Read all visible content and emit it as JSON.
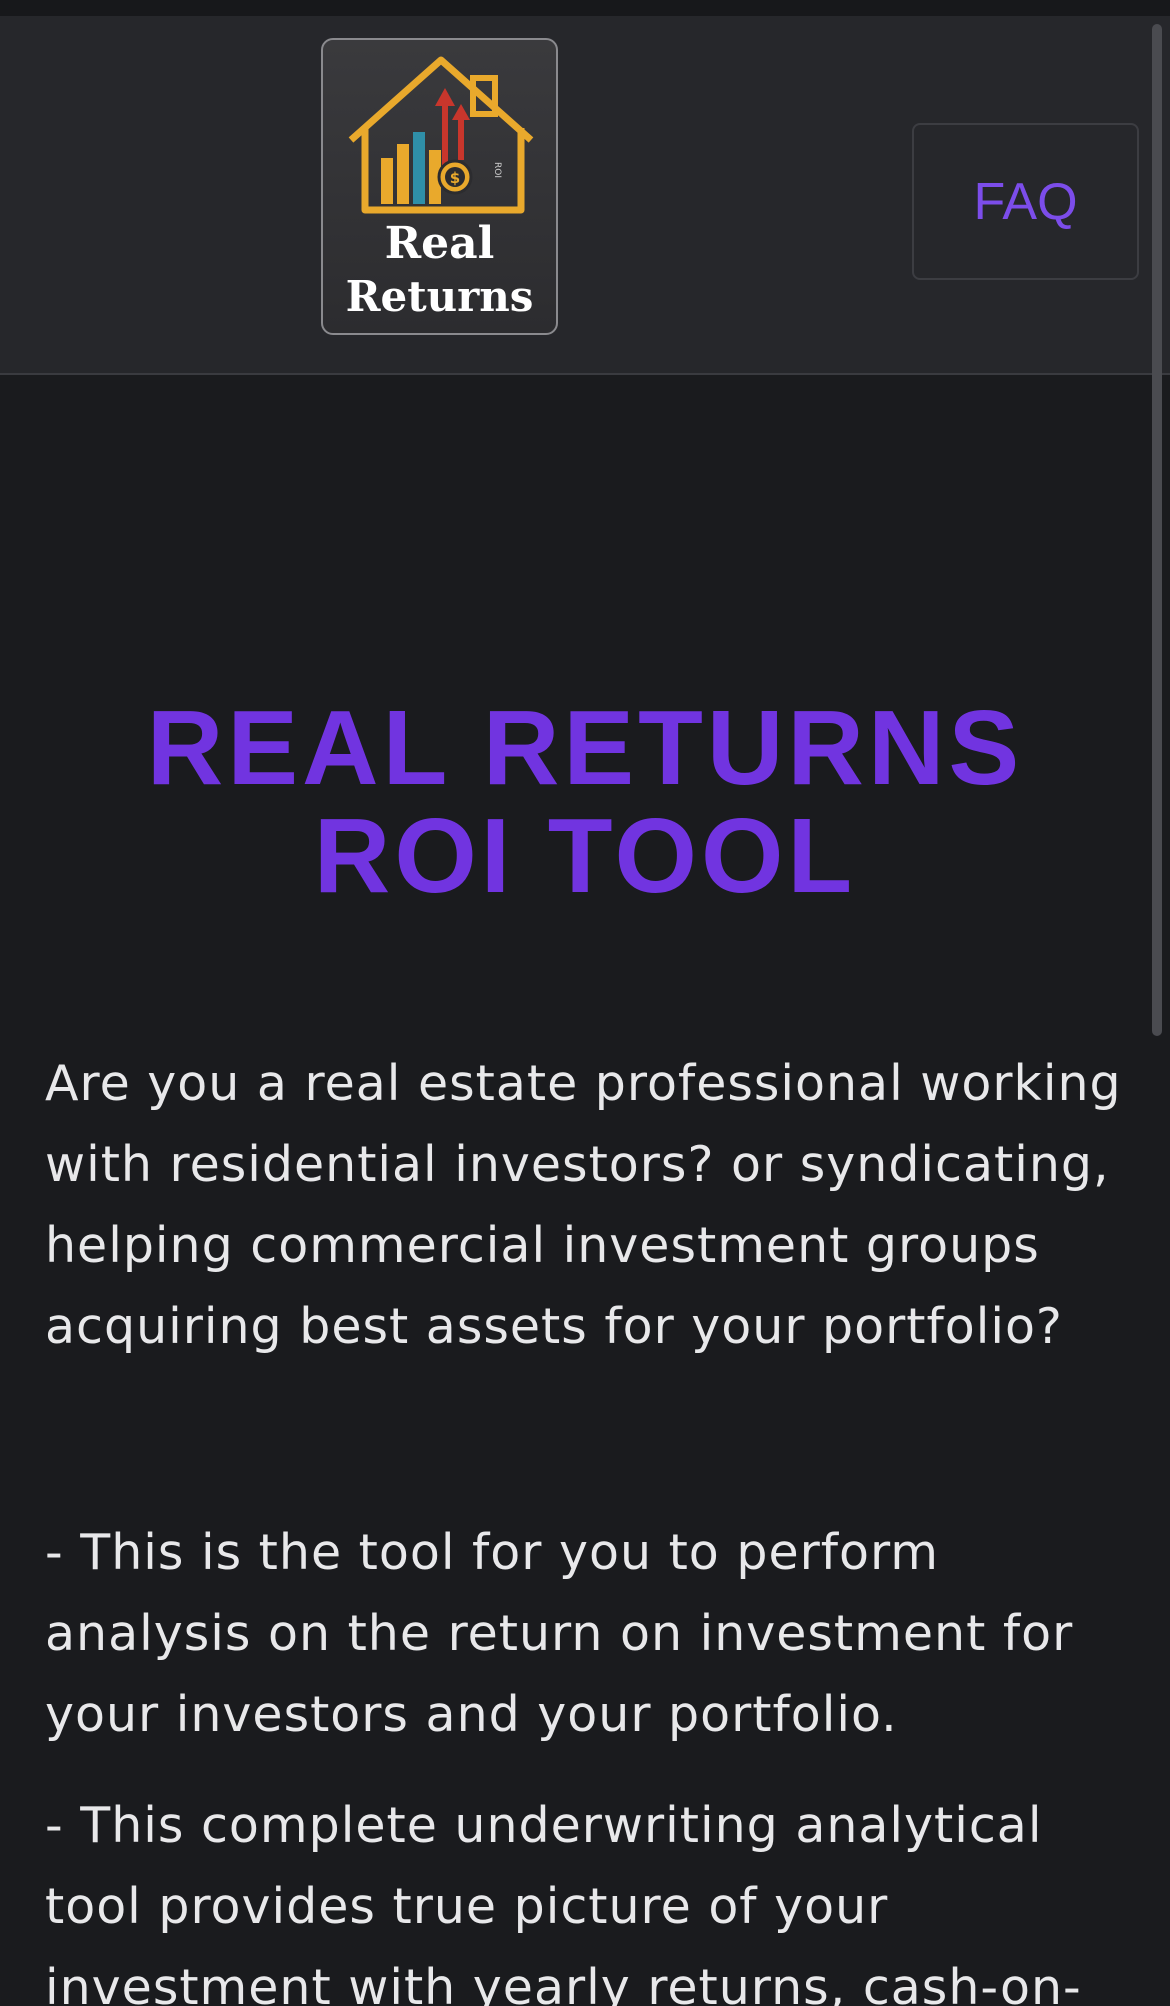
{
  "header": {
    "logo": {
      "line1": "Real",
      "line2": "Returns",
      "side_text": "ROI"
    },
    "faq_label": "FAQ"
  },
  "main": {
    "title": "REAL RETURNS ROI TOOL",
    "intro": "Are you a real estate professional working with residential investors? or syndicating, helping commercial investment groups acquiring best assets for your portfolio?",
    "bullet1": "- This is the tool for you to perform analysis on the return on investment for your investors and your portfolio.",
    "bullet2": "- This complete underwriting analytical tool provides true picture of your investment with yearly returns, cash-on-"
  },
  "colors": {
    "background": "#1a1b1e",
    "header_bg": "#26272b",
    "accent": "#7134e0",
    "faq_text": "#7c4dea",
    "body_text": "#e8e8ea"
  }
}
